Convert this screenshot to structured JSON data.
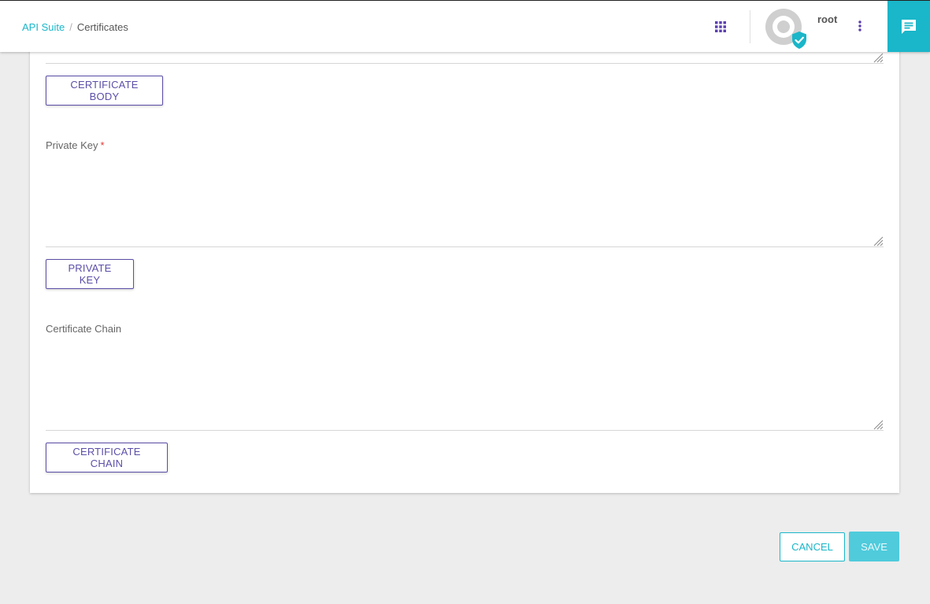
{
  "breadcrumb": {
    "root": "API Suite",
    "separator": "/",
    "current": "Certificates"
  },
  "user": {
    "name": "root"
  },
  "icons": {
    "apps": "apps-grid-icon",
    "more": "more-vert-icon",
    "chat": "chat-icon",
    "verified": "verified-shield-icon"
  },
  "colors": {
    "accent": "#1ab6c9",
    "primary_purple": "#5b4fa8",
    "required": "#e53935"
  },
  "form": {
    "certificate_body": {
      "value": "",
      "button_label": "CERTIFICATE BODY"
    },
    "private_key": {
      "label": "Private Key",
      "required_marker": "*",
      "value": "",
      "button_label": "PRIVATE KEY"
    },
    "certificate_chain": {
      "label": "Certificate Chain",
      "value": "",
      "button_label": "CERTIFICATE CHAIN"
    }
  },
  "actions": {
    "cancel_label": "CANCEL",
    "save_label": "SAVE"
  }
}
